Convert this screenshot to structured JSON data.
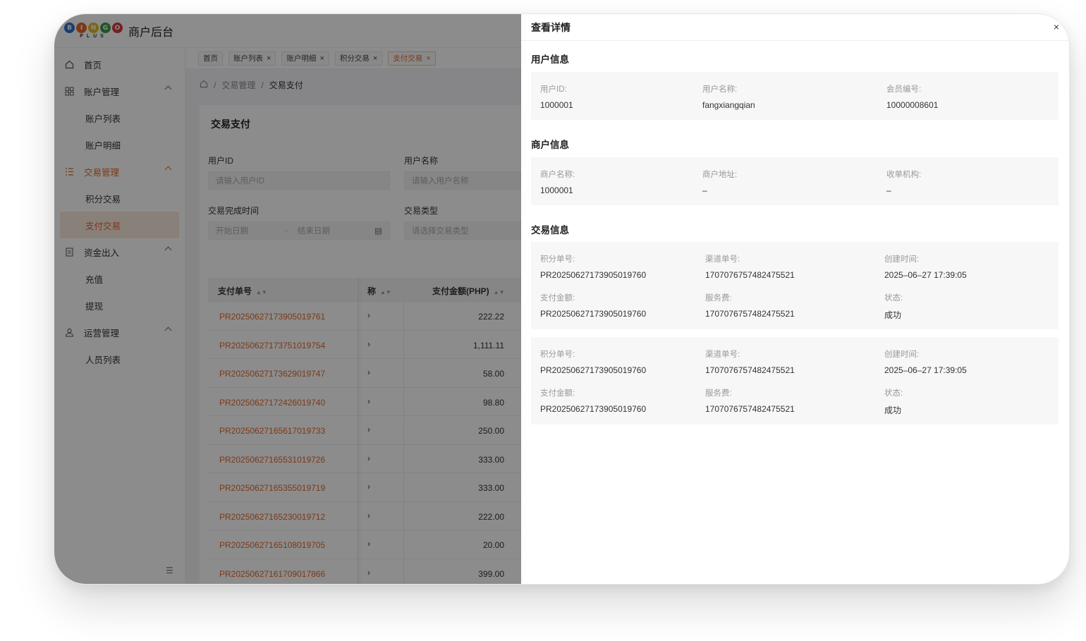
{
  "app": {
    "title": "商户后台",
    "logo_letters": [
      "B",
      "I",
      "N",
      "G",
      "O"
    ],
    "logo_sub": "PLUS"
  },
  "sidebar": {
    "items": [
      {
        "label": "首页",
        "icon": "home-icon"
      },
      {
        "label": "账户管理",
        "icon": "grid-icon",
        "children": [
          "账户列表",
          "账户明细"
        ]
      },
      {
        "label": "交易管理",
        "icon": "list-icon",
        "children": [
          "积分交易",
          "支付交易"
        ]
      },
      {
        "label": "资金出入",
        "icon": "document-icon",
        "children": [
          "充值",
          "提现"
        ]
      },
      {
        "label": "运营管理",
        "icon": "user-icon",
        "children": [
          "人员列表"
        ]
      }
    ]
  },
  "tabs": [
    "首页",
    "账户列表",
    "账户明细",
    "积分交易",
    "支付交易"
  ],
  "breadcrumb": {
    "section": "交易管理",
    "current": "交易支付"
  },
  "search": {
    "title": "交易支付",
    "user_id_label": "用户ID",
    "user_id_placeholder": "请输入用户ID",
    "user_name_label": "用户名称",
    "user_name_placeholder": "请输入用户名称",
    "time_label": "交易完成时间",
    "start_placeholder": "开始日期",
    "range_sep": "-",
    "end_placeholder": "结束日期",
    "type_label": "交易类型",
    "type_placeholder": "请选择交易类型"
  },
  "table": {
    "columns": [
      "支付单号",
      "称",
      "支付金额(PHP)"
    ],
    "rows": [
      {
        "no": "PR20250627173905019761",
        "mid": "›",
        "amount": "222.22"
      },
      {
        "no": "PR20250627173751019754",
        "mid": "›",
        "amount": "1,111.11"
      },
      {
        "no": "PR20250627173629019747",
        "mid": "›",
        "amount": "58.00"
      },
      {
        "no": "PR20250627172426019740",
        "mid": "›",
        "amount": "98.80"
      },
      {
        "no": "PR20250627165617019733",
        "mid": "›",
        "amount": "250.00"
      },
      {
        "no": "PR20250627165531019726",
        "mid": "›",
        "amount": "333.00"
      },
      {
        "no": "PR20250627165355019719",
        "mid": "›",
        "amount": "333.00"
      },
      {
        "no": "PR20250627165230019712",
        "mid": "›",
        "amount": "222.00"
      },
      {
        "no": "PR20250627165108019705",
        "mid": "›",
        "amount": "20.00"
      },
      {
        "no": "PR20250627161709017866",
        "mid": "›",
        "amount": "399.00"
      }
    ]
  },
  "drawer": {
    "title": "查看详情",
    "close": "×",
    "user_section": {
      "title": "用户信息",
      "fields": [
        {
          "k": "用户ID:",
          "v": "1000001"
        },
        {
          "k": "用户名称:",
          "v": "fangxiangqian"
        },
        {
          "k": "会员编号:",
          "v": "10000008601"
        }
      ]
    },
    "merchant_section": {
      "title": "商户信息",
      "fields": [
        {
          "k": "商户名称:",
          "v": "1000001"
        },
        {
          "k": "商户地址:",
          "v": "–"
        },
        {
          "k": "收单机构:",
          "v": "–"
        }
      ]
    },
    "trade_section": {
      "title": "交易信息",
      "records": [
        {
          "fields": [
            {
              "k": "积分单号:",
              "v": "PR20250627173905019760"
            },
            {
              "k": "渠道单号:",
              "v": "1707076757482475521"
            },
            {
              "k": "创建时间:",
              "v": "2025–06–27 17:39:05"
            },
            {
              "k": "支付金额:",
              "v": "PR20250627173905019760"
            },
            {
              "k": "服务费:",
              "v": "1707076757482475521"
            },
            {
              "k": "状态:",
              "v": "成功"
            }
          ]
        },
        {
          "fields": [
            {
              "k": "积分单号:",
              "v": "PR20250627173905019760"
            },
            {
              "k": "渠道单号:",
              "v": "1707076757482475521"
            },
            {
              "k": "创建时间:",
              "v": "2025–06–27 17:39:05"
            },
            {
              "k": "支付金额:",
              "v": "PR20250627173905019760"
            },
            {
              "k": "服务费:",
              "v": "1707076757482475521"
            },
            {
              "k": "状态:",
              "v": "成功"
            }
          ]
        }
      ]
    }
  },
  "colors": {
    "accent": "#e0692a",
    "mask": "rgba(0,0,0,0.45)"
  }
}
